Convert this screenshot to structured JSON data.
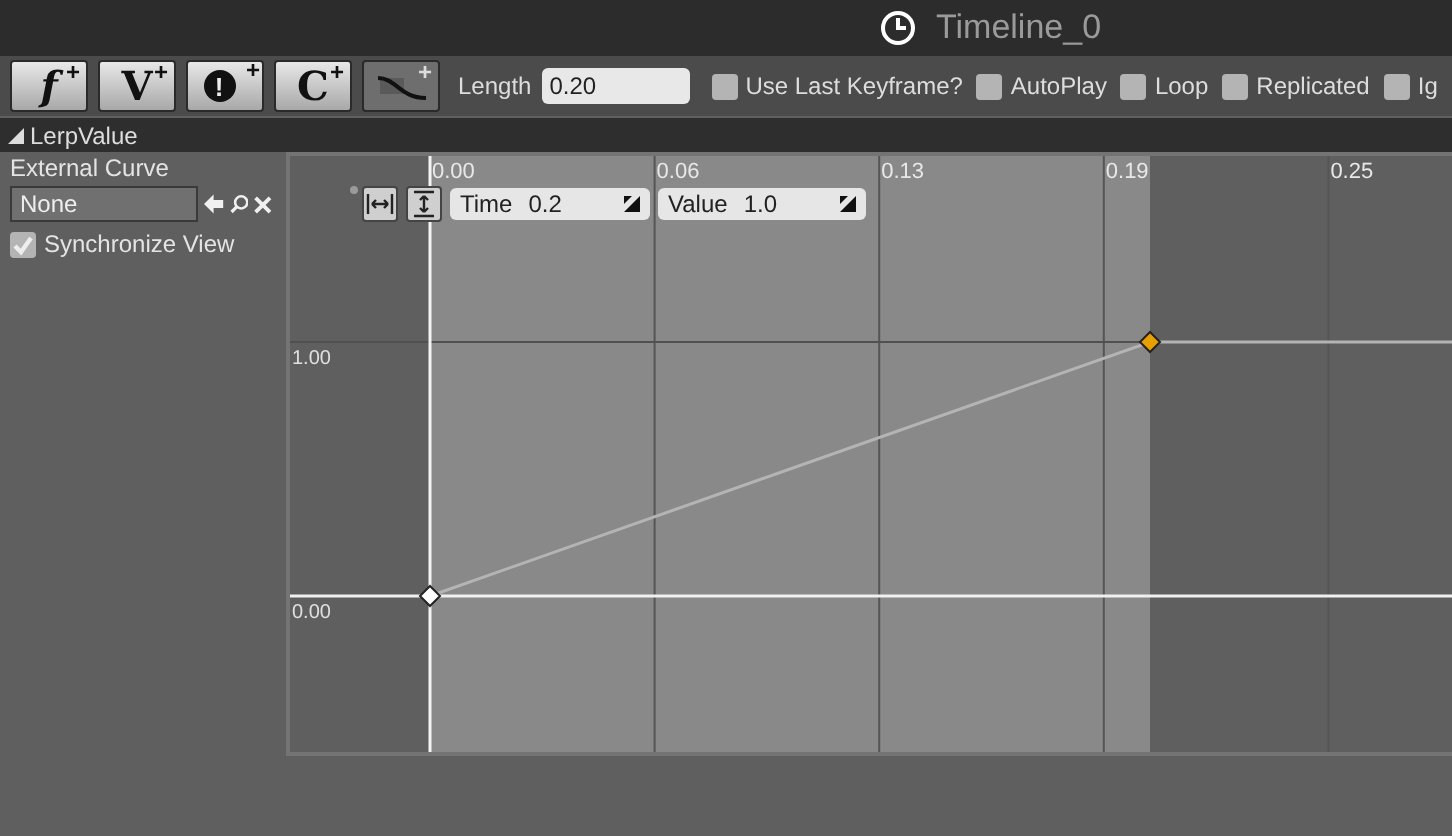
{
  "window": {
    "title": "Timeline_0"
  },
  "toolbar": {
    "buttons": [
      {
        "kind": "glyph",
        "label": "f",
        "plus": "+"
      },
      {
        "kind": "glyph",
        "label": "V",
        "plus": "+"
      },
      {
        "kind": "circle",
        "label": "!",
        "plus": "+"
      },
      {
        "kind": "glyph",
        "label": "C",
        "plus": "+"
      },
      {
        "kind": "curve",
        "plus": "+"
      }
    ],
    "length_label": "Length",
    "length_value": "0.20",
    "options": [
      {
        "label": "Use Last Keyframe?",
        "checked": false
      },
      {
        "label": "AutoPlay",
        "checked": false
      },
      {
        "label": "Loop",
        "checked": false
      },
      {
        "label": "Replicated",
        "checked": false
      },
      {
        "label": "Ig",
        "checked": false
      }
    ]
  },
  "track": {
    "name": "LerpValue",
    "expanded": true,
    "external_curve_label": "External Curve",
    "external_curve_value": "None",
    "synchronize_view": {
      "label": "Synchronize View",
      "checked": true
    },
    "key_fields": [
      {
        "label": "Time",
        "value": "0.2"
      },
      {
        "label": "Value",
        "value": "1.0"
      }
    ],
    "keys": [
      {
        "selected": false
      },
      {
        "selected": true
      }
    ],
    "time_ruler": [
      "0.00",
      "0.06",
      "0.13",
      "0.19",
      "0.25"
    ],
    "value_ruler": [
      "1.00",
      "0.00"
    ]
  }
}
